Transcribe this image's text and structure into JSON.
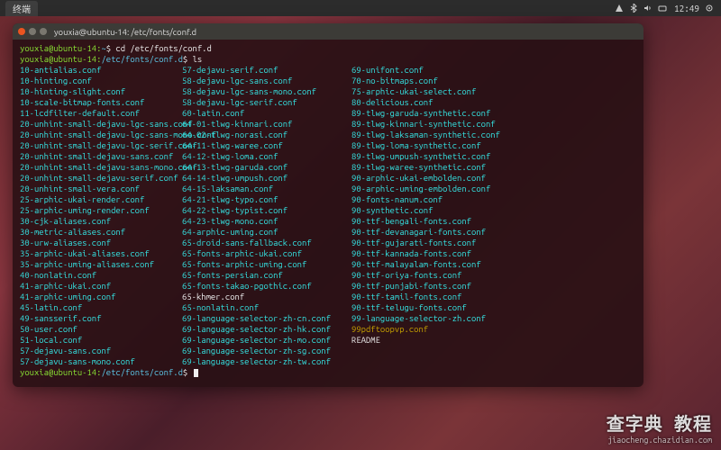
{
  "os": {
    "active_app": "终端",
    "clock": "12:49",
    "tray_icons": [
      "network-icon",
      "bluetooth-icon",
      "volume-icon",
      "keyboard-icon",
      "gear-icon"
    ]
  },
  "window": {
    "title": "youxia@ubuntu-14: /etc/fonts/conf.d"
  },
  "term": {
    "prompt1_user": "youxia@ubuntu-14",
    "prompt1_path": "~",
    "prompt1_cmd": "cd /etc/fonts/conf.d",
    "prompt2_user": "youxia@ubuntu-14",
    "prompt2_path": "/etc/fonts/conf.d",
    "prompt2_cmd": "ls",
    "prompt3_user": "youxia@ubuntu-14",
    "prompt3_path": "/etc/fonts/conf.d",
    "prompt3_cmd": "",
    "columns": [
      [
        "10-antialias.conf",
        "10-hinting.conf",
        "10-hinting-slight.conf",
        "10-scale-bitmap-fonts.conf",
        "11-lcdfilter-default.conf",
        "20-unhint-small-dejavu-lgc-sans.conf",
        "20-unhint-small-dejavu-lgc-sans-mono.conf",
        "20-unhint-small-dejavu-lgc-serif.conf",
        "20-unhint-small-dejavu-sans.conf",
        "20-unhint-small-dejavu-sans-mono.conf",
        "20-unhint-small-dejavu-serif.conf",
        "20-unhint-small-vera.conf",
        "25-arphic-ukai-render.conf",
        "25-arphic-uming-render.conf",
        "30-cjk-aliases.conf",
        "30-metric-aliases.conf",
        "30-urw-aliases.conf",
        "35-arphic-ukai-aliases.conf",
        "35-arphic-uming-aliases.conf",
        "40-nonlatin.conf",
        "41-arphic-ukai.conf",
        "41-arphic-uming.conf",
        "45-latin.conf",
        "49-sansserif.conf",
        "50-user.conf",
        "51-local.conf",
        "57-dejavu-sans.conf",
        "57-dejavu-sans-mono.conf"
      ],
      [
        "57-dejavu-serif.conf",
        "58-dejavu-lgc-sans.conf",
        "58-dejavu-lgc-sans-mono.conf",
        "58-dejavu-lgc-serif.conf",
        "60-latin.conf",
        "64-01-tlwg-kinnari.conf",
        "64-02-tlwg-norasi.conf",
        "64-11-tlwg-waree.conf",
        "64-12-tlwg-loma.conf",
        "64-13-tlwg-garuda.conf",
        "64-14-tlwg-umpush.conf",
        "64-15-laksaman.conf",
        "64-21-tlwg-typo.conf",
        "64-22-tlwg-typist.conf",
        "64-23-tlwg-mono.conf",
        "64-arphic-uming.conf",
        "65-droid-sans-fallback.conf",
        "65-fonts-arphic-ukai.conf",
        "65-fonts-arphic-uming.conf",
        "65-fonts-persian.conf",
        "65-fonts-takao-pgothic.conf",
        "65-khmer.conf",
        "65-nonlatin.conf",
        "69-language-selector-zh-cn.conf",
        "69-language-selector-zh-hk.conf",
        "69-language-selector-zh-mo.conf",
        "69-language-selector-zh-sg.conf",
        "69-language-selector-zh-tw.conf"
      ],
      [
        "69-unifont.conf",
        "70-no-bitmaps.conf",
        "75-arphic-ukai-select.conf",
        "80-delicious.conf",
        "89-tlwg-garuda-synthetic.conf",
        "89-tlwg-kinnari-synthetic.conf",
        "89-tlwg-laksaman-synthetic.conf",
        "89-tlwg-loma-synthetic.conf",
        "89-tlwg-umpush-synthetic.conf",
        "89-tlwg-waree-synthetic.conf",
        "90-arphic-ukai-embolden.conf",
        "90-arphic-uming-embolden.conf",
        "90-fonts-nanum.conf",
        "90-synthetic.conf",
        "90-ttf-bengali-fonts.conf",
        "90-ttf-devanagari-fonts.conf",
        "90-ttf-gujarati-fonts.conf",
        "90-ttf-kannada-fonts.conf",
        "90-ttf-malayalam-fonts.conf",
        "90-ttf-oriya-fonts.conf",
        "90-ttf-punjabi-fonts.conf",
        "90-ttf-tamil-fonts.conf",
        "90-ttf-telugu-fonts.conf",
        "99-language-selector-zh.conf",
        "99pdftoopvp.conf",
        "README"
      ]
    ],
    "special_white": [
      "65-khmer.conf",
      "README"
    ],
    "special_yellow": [
      "99pdftoopvp.conf"
    ]
  },
  "watermark": {
    "brand": "查字典  教程",
    "url": "jiaocheng.chazidian.com"
  }
}
